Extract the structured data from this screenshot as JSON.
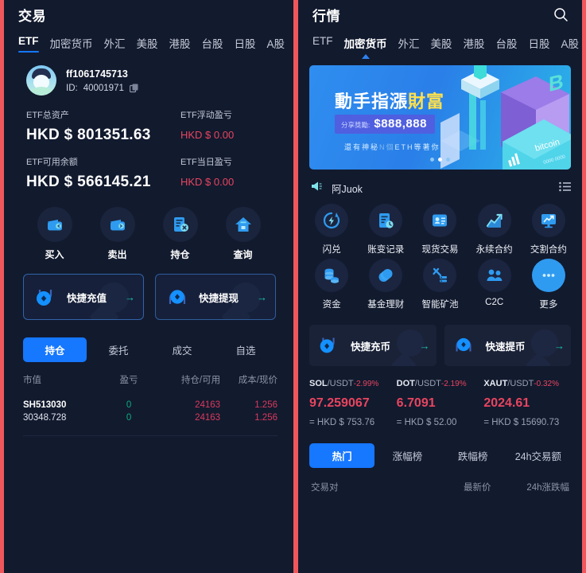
{
  "colors": {
    "frame": "#f0575c",
    "panel_bg": "#121a2e",
    "accent_blue": "#1677ff",
    "up_green": "#0dab7d",
    "down_red": "#d93a5c",
    "pnl_red": "#e8455f",
    "muted": "#8b93a6"
  },
  "left": {
    "header": {
      "title": "交易"
    },
    "tabs": [
      {
        "label": "ETF",
        "active": true
      },
      {
        "label": "加密货币",
        "active": false
      },
      {
        "label": "外汇",
        "active": false
      },
      {
        "label": "美股",
        "active": false
      },
      {
        "label": "港股",
        "active": false
      },
      {
        "label": "台股",
        "active": false
      },
      {
        "label": "日股",
        "active": false
      },
      {
        "label": "A股",
        "active": false
      }
    ],
    "account": {
      "name": "ff1061745713",
      "id_label": "ID:",
      "id_value": "40001971",
      "copy_icon": "copy-icon",
      "avatar_icon": "avatar"
    },
    "balances": [
      {
        "left_label": "ETF总资产",
        "left_currency": "HKD $",
        "left_value": "801351.63",
        "right_label": "ETF浮动盈亏",
        "right_currency": "HKD $",
        "right_value": "0.00"
      },
      {
        "left_label": "ETF可用余额",
        "left_currency": "HKD $",
        "left_value": "566145.21",
        "right_label": "ETF当日盈亏",
        "right_currency": "HKD $",
        "right_value": "0.00"
      }
    ],
    "actions": [
      {
        "label": "买入",
        "icon": "wallet-in-icon"
      },
      {
        "label": "卖出",
        "icon": "wallet-out-icon"
      },
      {
        "label": "持仓",
        "icon": "position-cancel-icon"
      },
      {
        "label": "查询",
        "icon": "home-query-icon"
      }
    ],
    "quick": [
      {
        "label": "快捷充值",
        "icon": "deposit-token-icon",
        "arrow": "→"
      },
      {
        "label": "快捷提现",
        "icon": "withdraw-token-icon",
        "arrow": "→"
      }
    ],
    "sub_tabs": [
      {
        "label": "持仓",
        "active": true
      },
      {
        "label": "委托",
        "active": false
      },
      {
        "label": "成交",
        "active": false
      },
      {
        "label": "自选",
        "active": false
      }
    ],
    "table": {
      "headers": [
        "市值",
        "盈亏",
        "持仓/可用",
        "成本/现价"
      ],
      "rows": [
        {
          "line1": [
            "SH513030",
            "0",
            "24163",
            "1.256"
          ],
          "line2": [
            "30348.728",
            "0",
            "24163",
            "1.256"
          ]
        }
      ]
    }
  },
  "right": {
    "header": {
      "title": "行情",
      "search_icon": "search-icon"
    },
    "tabs": [
      {
        "label": "ETF",
        "active": false
      },
      {
        "label": "加密货币",
        "active": true
      },
      {
        "label": "外汇",
        "active": false
      },
      {
        "label": "美股",
        "active": false
      },
      {
        "label": "港股",
        "active": false
      },
      {
        "label": "台股",
        "active": false
      },
      {
        "label": "日股",
        "active": false
      },
      {
        "label": "A股",
        "active": false
      }
    ],
    "banner": {
      "headline_main": "動手指漲",
      "headline_accent": "財富",
      "chip_label": "分享獎勵:",
      "chip_amount": "$888,888",
      "subline_a": "還有神秘",
      "subline_b": "N個",
      "subline_c": "ETH等著你",
      "dots": 3,
      "active_dot": 2
    },
    "notice": {
      "icon": "megaphone-icon",
      "text": "阿Juok",
      "menu_icon": "list-menu-icon"
    },
    "grid": [
      {
        "label": "闪兑",
        "icon": "flash-swap-icon"
      },
      {
        "label": "账变记录",
        "icon": "account-history-icon"
      },
      {
        "label": "现货交易",
        "icon": "spot-trade-icon"
      },
      {
        "label": "永续合约",
        "icon": "perpetual-chart-icon"
      },
      {
        "label": "交割合约",
        "icon": "futures-monitor-icon"
      },
      {
        "label": "资金",
        "icon": "coins-icon"
      },
      {
        "label": "基金理财",
        "icon": "fund-wealth-icon"
      },
      {
        "label": "智能矿池",
        "icon": "mining-pool-icon"
      },
      {
        "label": "C2C",
        "icon": "people-icon"
      },
      {
        "label": "更多",
        "icon": "more-dots-icon"
      }
    ],
    "quick": [
      {
        "label": "快捷充币",
        "icon": "deposit-token-icon",
        "arrow": "→"
      },
      {
        "label": "快速提币",
        "icon": "withdraw-token-icon",
        "arrow": "→"
      }
    ],
    "tickers": [
      {
        "base": "SOL",
        "quote": "/USDT",
        "change": "-2.99%",
        "price": "97.259067",
        "converted": "= HKD $ 753.76"
      },
      {
        "base": "DOT",
        "quote": "/USDT",
        "change": "-2.19%",
        "price": "6.7091",
        "converted": "= HKD $ 52.00"
      },
      {
        "base": "XAUT",
        "quote": "/USDT",
        "change": "-0.32%",
        "price": "2024.61",
        "converted": "= HKD $ 15690.73"
      }
    ],
    "rank_tabs": [
      {
        "label": "热门",
        "active": true
      },
      {
        "label": "涨幅榜",
        "active": false
      },
      {
        "label": "跌幅榜",
        "active": false
      },
      {
        "label": "24h交易额",
        "active": false
      }
    ],
    "rank_headers": [
      "交易对",
      "最新价",
      "24h涨跌幅"
    ]
  }
}
